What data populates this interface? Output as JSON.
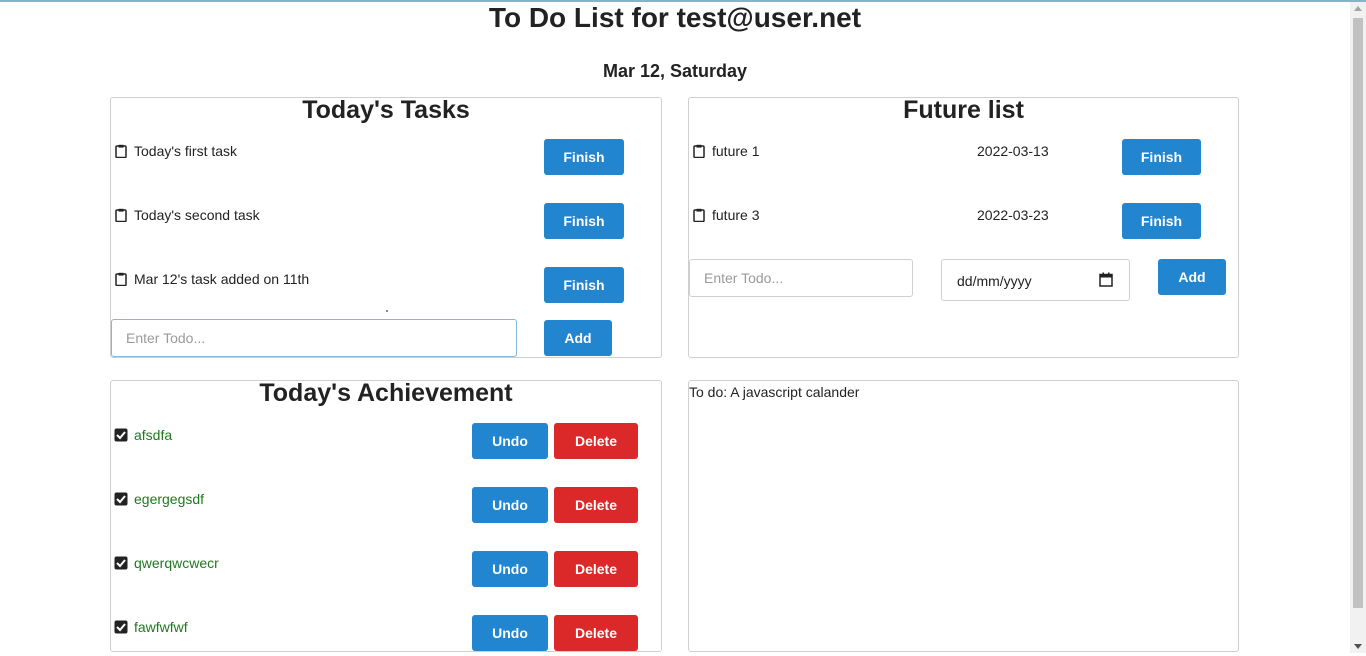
{
  "header": {
    "title": "To Do List for test@user.net",
    "date": "Mar 12, Saturday"
  },
  "today": {
    "title": "Today's Tasks",
    "tasks": [
      {
        "label": "Today's first task",
        "action": "Finish"
      },
      {
        "label": "Today's second task",
        "action": "Finish"
      },
      {
        "label": "Mar 12's task added on 11th",
        "action": "Finish"
      }
    ],
    "input_placeholder": "Enter Todo...",
    "add_label": "Add"
  },
  "future": {
    "title": "Future list",
    "tasks": [
      {
        "label": "future 1",
        "date": "2022-03-13",
        "action": "Finish"
      },
      {
        "label": "future 3",
        "date": "2022-03-23",
        "action": "Finish"
      }
    ],
    "input_placeholder": "Enter Todo...",
    "date_placeholder": "dd/mm/yyyy",
    "add_label": "Add"
  },
  "achievement": {
    "title": "Today's Achievement",
    "items": [
      {
        "label": "afsdfa",
        "undo": "Undo",
        "delete": "Delete"
      },
      {
        "label": "egergegsdf",
        "undo": "Undo",
        "delete": "Delete"
      },
      {
        "label": "qwerqwcwecr",
        "undo": "Undo",
        "delete": "Delete"
      },
      {
        "label": "fawfwfwf",
        "undo": "Undo",
        "delete": "Delete"
      }
    ]
  },
  "notes": {
    "text": "To do: A javascript calander"
  },
  "colors": {
    "primary": "#2185d0",
    "danger": "#db2828",
    "done_text": "#1e7a1e"
  },
  "icons": {
    "task": "clipboard-icon",
    "done": "checked-box-icon",
    "calendar": "calendar-icon"
  }
}
